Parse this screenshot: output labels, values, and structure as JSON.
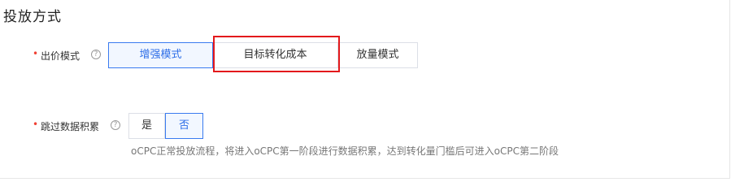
{
  "section": {
    "title": "投放方式"
  },
  "bid_mode": {
    "required_mark": "•",
    "label": "出价模式",
    "help_icon": "question-circle-icon",
    "help_glyph": "?",
    "options": [
      {
        "label": "增强模式",
        "selected": true
      },
      {
        "label": "目标转化成本",
        "selected": false
      },
      {
        "label": "放量模式",
        "selected": false
      }
    ]
  },
  "skip_accumulation": {
    "required_mark": "•",
    "label": "跳过数据积累",
    "help_icon": "question-circle-icon",
    "help_glyph": "?",
    "options": [
      {
        "label": "是",
        "selected": false
      },
      {
        "label": "否",
        "selected": true
      }
    ],
    "hint": "oCPC正常投放流程，将进入oCPC第一阶段进行数据积累，达到转化量门槛后可进入oCPC第二阶段"
  },
  "colors": {
    "accent": "#3a7bf0",
    "highlight": "#e3191c",
    "required": "#f04134"
  }
}
